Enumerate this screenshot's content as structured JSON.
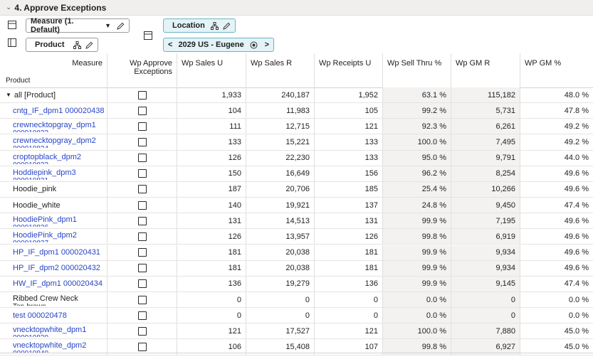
{
  "section": {
    "title": "4. Approve Exceptions"
  },
  "toolbar": {
    "measure_label": "Measure (1. Default)",
    "product_label": "Product",
    "location_label": "Location",
    "location_value": "2029 US - Eugene",
    "prev_label": "<",
    "next_label": ">"
  },
  "grid": {
    "measure_header": "Measure",
    "product_header": "Product",
    "columns": [
      "Wp Approve Exceptions",
      "Wp Sales U",
      "Wp Sales R",
      "Wp Receipts U",
      "Wp Sell Thru %",
      "Wp GM R",
      "WP GM %"
    ],
    "rows": [
      {
        "product": "all [Product]",
        "sub": "",
        "link": false,
        "expander": true,
        "values": [
          "1,933",
          "240,187",
          "1,952",
          "63.1 %",
          "115,182",
          "48.0 %"
        ]
      },
      {
        "product": "cntg_IF_dpm1 000020438",
        "sub": "",
        "link": true,
        "values": [
          "104",
          "11,983",
          "105",
          "99.2 %",
          "5,731",
          "47.8 %"
        ]
      },
      {
        "product": "crewnecktopgray_dpm1",
        "sub": "000010833",
        "link": true,
        "values": [
          "111",
          "12,715",
          "121",
          "92.3 %",
          "6,261",
          "49.2 %"
        ]
      },
      {
        "product": "crewnecktopgray_dpm2",
        "sub": "000010834",
        "link": true,
        "values": [
          "133",
          "15,221",
          "133",
          "100.0 %",
          "7,495",
          "49.2 %"
        ]
      },
      {
        "product": "croptopblack_dpm2",
        "sub": "000010832",
        "link": true,
        "values": [
          "126",
          "22,230",
          "133",
          "95.0 %",
          "9,791",
          "44.0 %"
        ]
      },
      {
        "product": "Hoddiepink_dpm3",
        "sub": "000010831",
        "link": true,
        "values": [
          "150",
          "16,649",
          "156",
          "96.2 %",
          "8,254",
          "49.6 %"
        ]
      },
      {
        "product": "Hoodie_pink",
        "sub": "",
        "link": false,
        "values": [
          "187",
          "20,706",
          "185",
          "25.4 %",
          "10,266",
          "49.6 %"
        ]
      },
      {
        "product": "Hoodie_white",
        "sub": "",
        "link": false,
        "values": [
          "140",
          "19,921",
          "137",
          "24.8 %",
          "9,450",
          "47.4 %"
        ]
      },
      {
        "product": "HoodiePink_dpm1",
        "sub": "000010836",
        "link": true,
        "values": [
          "131",
          "14,513",
          "131",
          "99.9 %",
          "7,195",
          "49.6 %"
        ]
      },
      {
        "product": "HoodiePink_dpm2",
        "sub": "000010837",
        "link": true,
        "values": [
          "126",
          "13,957",
          "126",
          "99.8 %",
          "6,919",
          "49.6 %"
        ]
      },
      {
        "product": "HP_IF_dpm1 000020431",
        "sub": "",
        "link": true,
        "values": [
          "181",
          "20,038",
          "181",
          "99.9 %",
          "9,934",
          "49.6 %"
        ]
      },
      {
        "product": "HP_IF_dpm2 000020432",
        "sub": "",
        "link": true,
        "values": [
          "181",
          "20,038",
          "181",
          "99.9 %",
          "9,934",
          "49.6 %"
        ]
      },
      {
        "product": "HW_IF_dpm1 000020434",
        "sub": "",
        "link": true,
        "values": [
          "136",
          "19,279",
          "136",
          "99.9 %",
          "9,145",
          "47.4 %"
        ]
      },
      {
        "product": "Ribbed Crew Neck",
        "sub": "Top-brown",
        "link": false,
        "values": [
          "0",
          "0",
          "0",
          "0.0 %",
          "0",
          "0.0 %"
        ]
      },
      {
        "product": "test 000020478",
        "sub": "",
        "link": true,
        "values": [
          "0",
          "0",
          "0",
          "0.0 %",
          "0",
          "0.0 %"
        ]
      },
      {
        "product": "vnecktopwhite_dpm1",
        "sub": "000010839",
        "link": true,
        "values": [
          "121",
          "17,527",
          "121",
          "100.0 %",
          "7,880",
          "45.0 %"
        ]
      },
      {
        "product": "vnecktopwhite_dpm2",
        "sub": "000010840",
        "link": true,
        "values": [
          "106",
          "15,408",
          "107",
          "99.8 %",
          "6,927",
          "45.0 %"
        ]
      }
    ]
  },
  "colors": {
    "link": "#2845c6",
    "accent": "#2b6aa6",
    "shade": "#f3f2f1",
    "header_bg": "#f1efed"
  }
}
